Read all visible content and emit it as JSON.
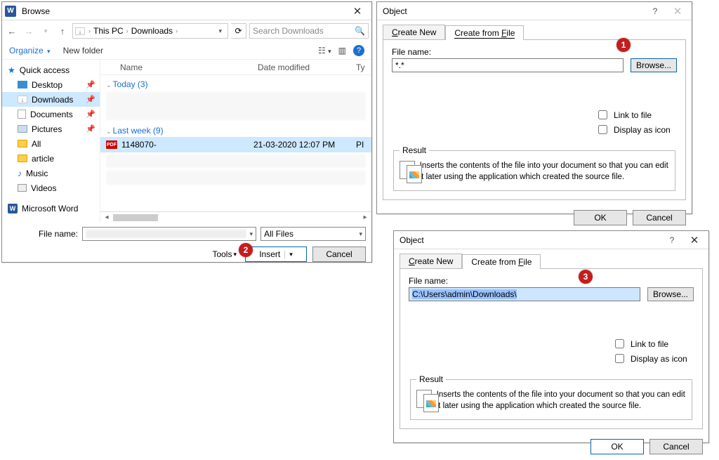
{
  "browse": {
    "title": "Browse",
    "breadcrumb": {
      "root": "This PC",
      "folder": "Downloads"
    },
    "search_placeholder": "Search Downloads",
    "organize": "Organize",
    "new_folder": "New folder",
    "cols": {
      "name": "Name",
      "date": "Date modified",
      "type": "Ty"
    },
    "group_today": "Today (3)",
    "group_lastweek": "Last week (9)",
    "file": {
      "name": "1148070-",
      "date": "21-03-2020 12:07 PM",
      "type": "PI"
    },
    "filename_label": "File name:",
    "filetype": "All Files",
    "tools": "Tools",
    "insert": "Insert",
    "cancel": "Cancel",
    "sidebar": {
      "quick": "Quick access",
      "desktop": "Desktop",
      "downloads": "Downloads",
      "documents": "Documents",
      "pictures": "Pictures",
      "all": "All",
      "article": "article",
      "music": "Music",
      "videos": "Videos",
      "msword": "Microsoft Word"
    }
  },
  "obj_shared": {
    "title": "Object",
    "tab_new": "Create New",
    "tab_file": "Create from File",
    "filename_label": "File name:",
    "browse": "Browse...",
    "link": "Link to file",
    "icon": "Display as icon",
    "result_legend": "Result",
    "result_text": "Inserts the contents of the file into your document so that you can edit it later using the application which created the source file.",
    "ok": "OK",
    "cancel": "Cancel"
  },
  "obj1": {
    "filename_value": "*.*"
  },
  "obj2": {
    "filename_value": "C:\\Users\\admin\\Downloads\\"
  },
  "badges": {
    "b1": "1",
    "b2": "2",
    "b3": "3"
  }
}
